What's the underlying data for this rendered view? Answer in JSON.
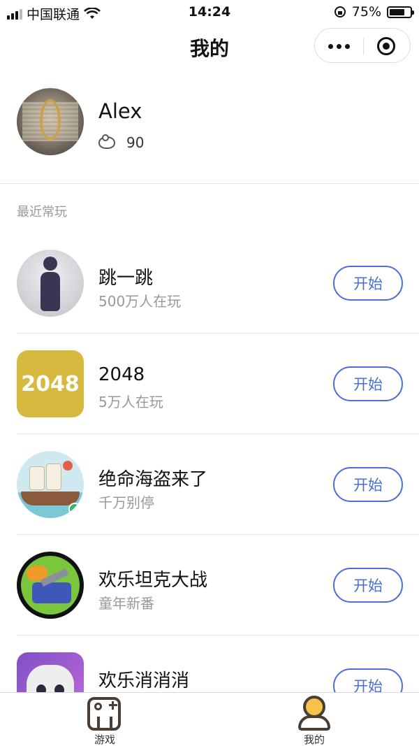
{
  "status_bar": {
    "carrier": "中国联通",
    "time": "14:24",
    "battery": "75%",
    "battery_level": 0.75
  },
  "nav": {
    "title": "我的"
  },
  "profile": {
    "username": "Alex",
    "coins": "90"
  },
  "recent": {
    "label": "最近常玩",
    "start_label": "开始",
    "games": [
      {
        "name": "跳一跳",
        "subtitle": "500万人在玩",
        "icon": "jump-jump-icon"
      },
      {
        "name": "2048",
        "subtitle": "5万人在玩",
        "icon": "game-2048-icon",
        "icon_text": "2048"
      },
      {
        "name": "绝命海盗来了",
        "subtitle": "千万别停",
        "icon": "pirate-ship-icon"
      },
      {
        "name": "欢乐坦克大战",
        "subtitle": "童年新番",
        "icon": "tank-icon"
      },
      {
        "name": "欢乐消消消",
        "subtitle": "",
        "icon": "cat-icon"
      }
    ]
  },
  "tabbar": {
    "games": "游戏",
    "mine": "我的"
  },
  "colors": {
    "accent": "#4a6ed4",
    "tile_2048": "#d8b93f"
  }
}
